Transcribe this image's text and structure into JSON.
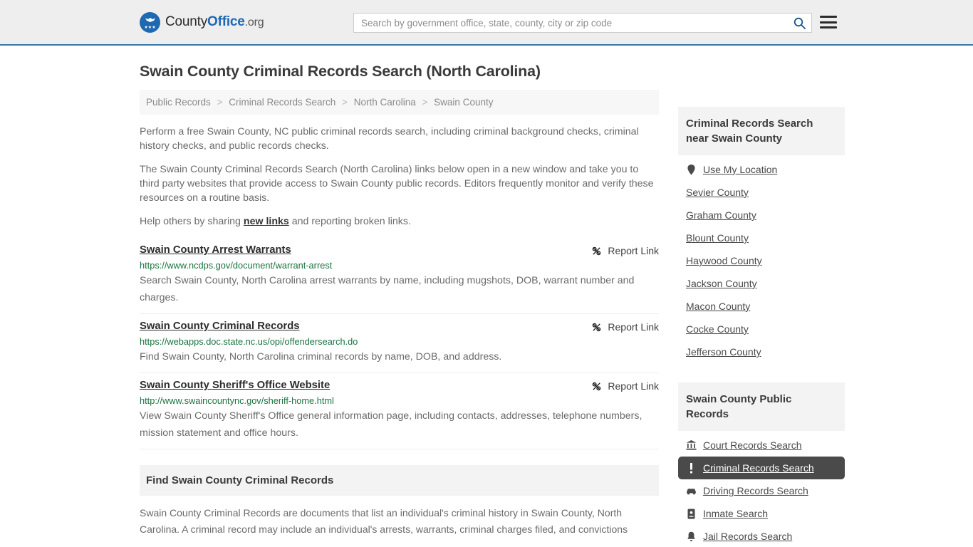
{
  "header": {
    "brand": {
      "part1": "County",
      "part2": "Office",
      "part3": ".org",
      "logo_icon": "eagle-seal-icon"
    },
    "search": {
      "placeholder": "Search by government office, state, county, city or zip code",
      "value": "",
      "icon": "search-icon"
    },
    "menu_icon": "hamburger-menu-icon"
  },
  "page": {
    "title": "Swain County Criminal Records Search (North Carolina)"
  },
  "breadcrumb": [
    {
      "label": "Public Records"
    },
    {
      "label": "Criminal Records Search"
    },
    {
      "label": "North Carolina"
    },
    {
      "label": "Swain County"
    }
  ],
  "breadcrumb_separator": ">",
  "intro": {
    "p1": "Perform a free Swain County, NC public criminal records search, including criminal background checks, criminal history checks, and public records checks.",
    "p2": "The Swain County Criminal Records Search (North Carolina) links below open in a new window and take you to third party websites that provide access to Swain County public records. Editors frequently monitor and verify these resources on a routine basis.",
    "p3_before": "Help others by sharing ",
    "p3_link": "new links",
    "p3_after": " and reporting broken links."
  },
  "report_link_label": "Report Link",
  "report_link_icon": "broken-link-icon",
  "results": [
    {
      "title": "Swain County Arrest Warrants",
      "url": "https://www.ncdps.gov/document/warrant-arrest",
      "description": "Search Swain County, North Carolina arrest warrants by name, including mugshots, DOB, warrant number and charges."
    },
    {
      "title": "Swain County Criminal Records",
      "url": "https://webapps.doc.state.nc.us/opi/offendersearch.do",
      "description": "Find Swain County, North Carolina criminal records by name, DOB, and address."
    },
    {
      "title": "Swain County Sheriff's Office Website",
      "url": "http://www.swaincountync.gov/sheriff-home.html",
      "description": "View Swain County Sheriff's Office general information page, including contacts, addresses, telephone numbers, mission statement and office hours."
    }
  ],
  "find_section": {
    "heading": "Find Swain County Criminal Records",
    "body": "Swain County Criminal Records are documents that list an individual's criminal history in Swain County, North Carolina. A criminal record may include an individual's arrests, warrants, criminal charges filed, and convictions"
  },
  "sidebar": {
    "nearby": {
      "heading": "Criminal Records Search near Swain County",
      "use_my_location": {
        "label": "Use My Location",
        "icon": "map-pin-icon"
      },
      "counties": [
        {
          "label": "Sevier County"
        },
        {
          "label": "Graham County"
        },
        {
          "label": "Blount County"
        },
        {
          "label": "Haywood County"
        },
        {
          "label": "Jackson County"
        },
        {
          "label": "Macon County"
        },
        {
          "label": "Cocke County"
        },
        {
          "label": "Jefferson County"
        }
      ]
    },
    "public_records": {
      "heading": "Swain County Public Records",
      "items": [
        {
          "label": "Court Records Search",
          "icon": "courthouse-icon",
          "active": false
        },
        {
          "label": "Criminal Records Search",
          "icon": "exclamation-icon",
          "active": true
        },
        {
          "label": "Driving Records Search",
          "icon": "car-icon",
          "active": false
        },
        {
          "label": "Inmate Search",
          "icon": "id-badge-icon",
          "active": false
        },
        {
          "label": "Jail Records Search",
          "icon": "bell-icon",
          "active": false
        }
      ]
    }
  },
  "colors": {
    "brand_blue": "#1f69b3",
    "header_border": "#3b77a8",
    "url_green": "#1a7340",
    "active_bg": "#4a4a4a",
    "panel_gray": "#f3f3f3"
  }
}
